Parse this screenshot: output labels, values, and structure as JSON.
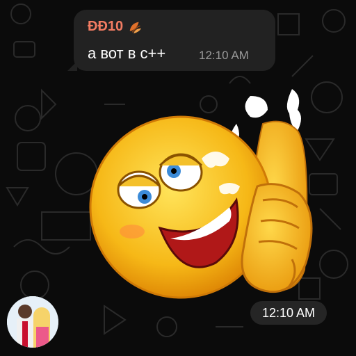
{
  "message": {
    "sender": "ÐÐ10",
    "sender_icon": "leaf-icon",
    "text": "а вот в с++",
    "time": "12:10 AM"
  },
  "sticker": {
    "time": "12:10 AM",
    "icon": "emoji-sticker"
  },
  "colors": {
    "sender_name": "#f27c62",
    "bubble_bg": "#222222",
    "background": "#0b0b0b"
  }
}
